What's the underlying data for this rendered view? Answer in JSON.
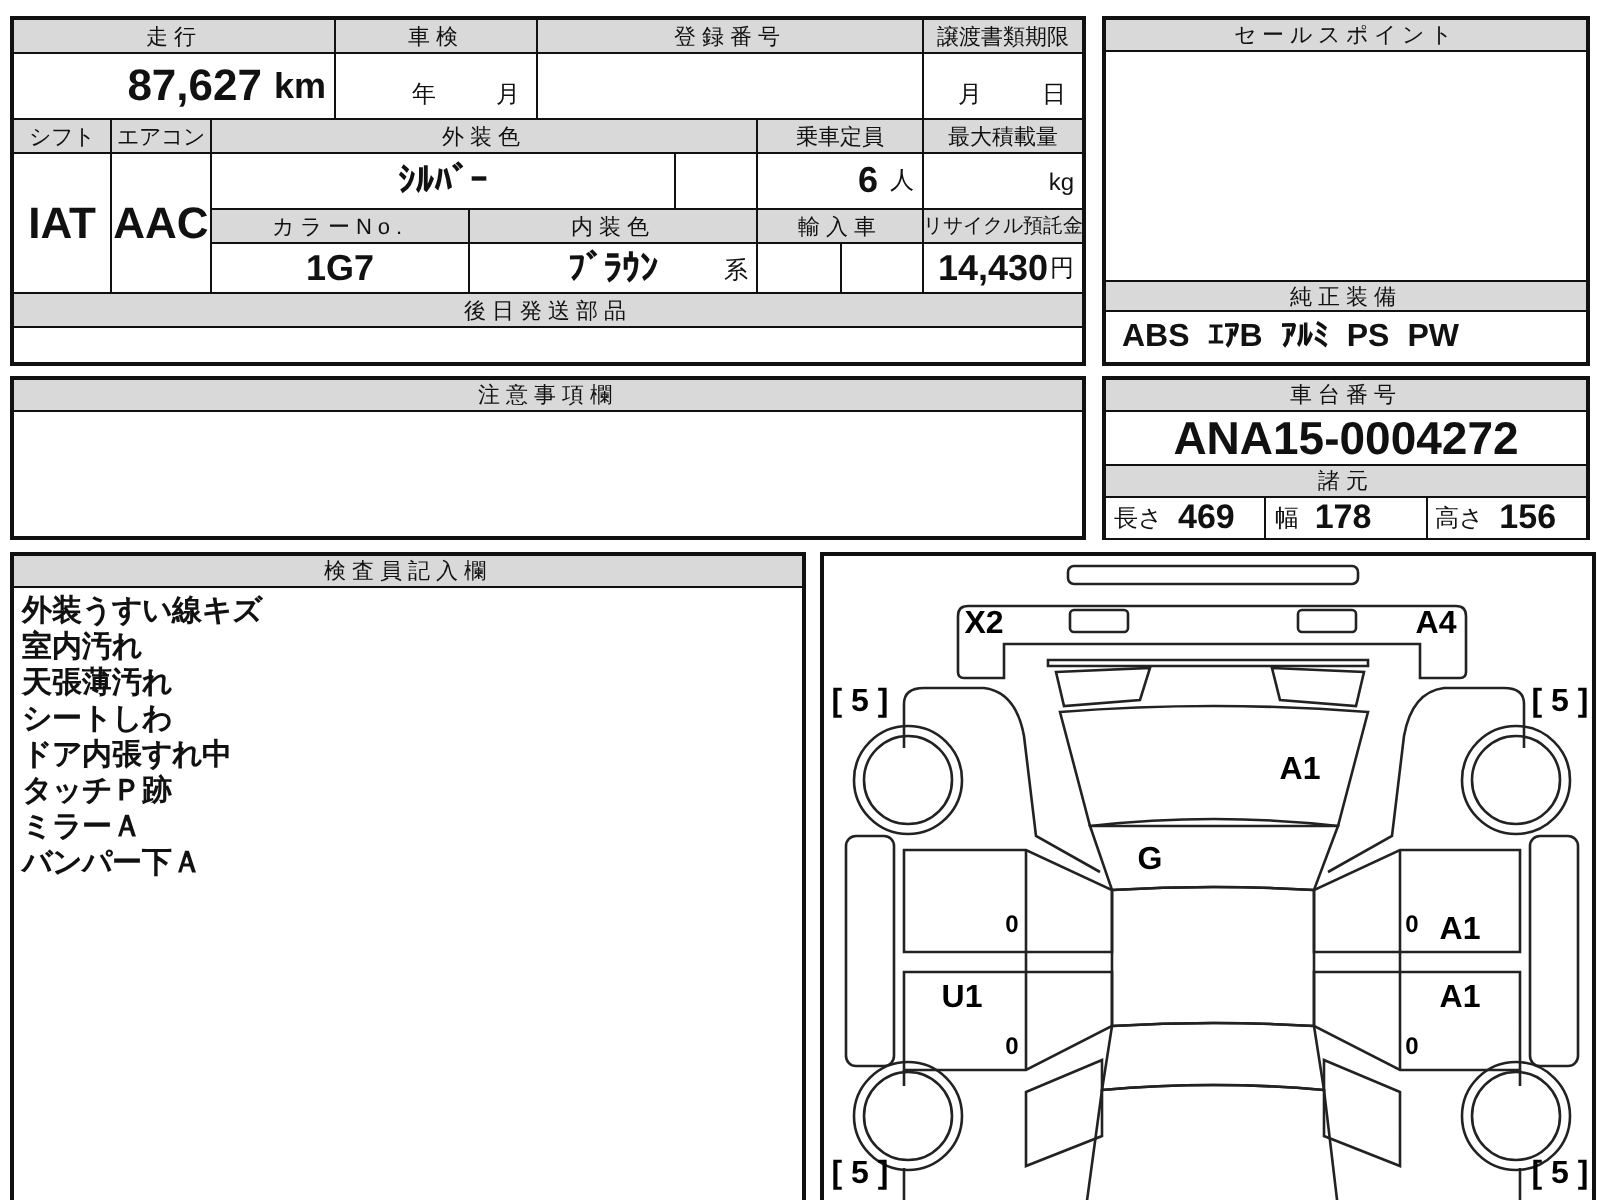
{
  "vehicle_table": {
    "mileage": {
      "label": "走行",
      "value": "87,627",
      "unit": "km"
    },
    "inspection": {
      "label": "車検",
      "year_unit": "年",
      "month_unit": "月"
    },
    "registration_number": {
      "label": "登録番号"
    },
    "transfer_deadline": {
      "label": "譲渡書類期限",
      "month_unit": "月",
      "day_unit": "日"
    },
    "shift": {
      "label": "シフト",
      "value": "IAT"
    },
    "aircon": {
      "label": "エアコン",
      "value": "AAC"
    },
    "exterior_color": {
      "label": "外装色",
      "value": "ｼﾙﾊﾞｰ"
    },
    "capacity": {
      "label": "乗車定員",
      "value": "6",
      "unit": "人"
    },
    "max_load": {
      "label": "最大積載量",
      "unit": "kg"
    },
    "color_no": {
      "label": "カラーNo.",
      "value": "1G7"
    },
    "interior_color": {
      "label": "内装色",
      "value": "ﾌﾞﾗｳﾝ",
      "suffix": "系"
    },
    "imported": {
      "label": "輸入車"
    },
    "recycle_deposit": {
      "label": "リサイクル預託金",
      "value": "14,430",
      "unit": "円"
    },
    "later_parts": {
      "label": "後日発送部品"
    }
  },
  "sales_point": {
    "label": "セールスポイント"
  },
  "genuine_equipment": {
    "label": "純正装備",
    "items": [
      "ABS",
      "ｴｱB",
      "ｱﾙﾐ",
      "PS",
      "PW"
    ]
  },
  "notes": {
    "label": "注意事項欄"
  },
  "chassis": {
    "label": "車台番号",
    "value": "ANA15-0004272"
  },
  "specs": {
    "label": "諸元",
    "items": [
      {
        "label": "長さ",
        "value": "469"
      },
      {
        "label": "幅",
        "value": "178"
      },
      {
        "label": "高さ",
        "value": "156"
      }
    ]
  },
  "inspector_notes": {
    "label": "検査員記入欄",
    "lines": [
      "外装うすい線キズ",
      "室内汚れ",
      "天張薄汚れ",
      "シートしわ",
      "ドア内張すれ中",
      "タッチＰ跡",
      "ミラーＡ",
      "バンパー下Ａ"
    ]
  },
  "diagram": {
    "marks": [
      {
        "text": "X2"
      },
      {
        "text": "A4"
      },
      {
        "text": "[ 5 ]"
      },
      {
        "text": "[ 5 ]"
      },
      {
        "text": "A1"
      },
      {
        "text": "G"
      },
      {
        "text": "0"
      },
      {
        "text": "0"
      },
      {
        "text": "A1"
      },
      {
        "text": "U1"
      },
      {
        "text": "A1"
      },
      {
        "text": "0"
      },
      {
        "text": "0"
      },
      {
        "text": "[ 5 ]"
      },
      {
        "text": "[ 5 ]"
      }
    ]
  }
}
